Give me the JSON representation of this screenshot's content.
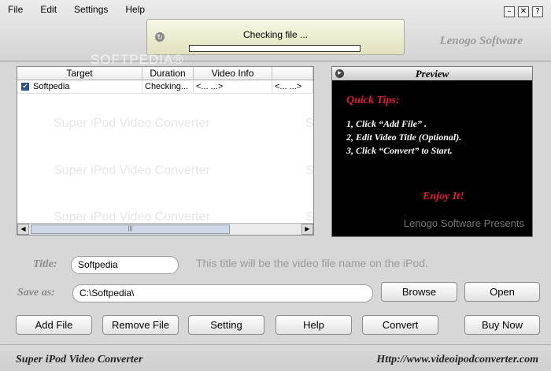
{
  "menu": [
    "File",
    "Edit",
    "Settings",
    "Help"
  ],
  "window_buttons": {
    "minimize": "–",
    "close": "✕",
    "help": "?"
  },
  "status": {
    "text": "Checking file ...",
    "progress": 0.0
  },
  "brand": "Lenogo Software",
  "watermark": "SOFTPEDIA®",
  "list": {
    "columns": [
      "Target",
      "Duration",
      "Video Info",
      ""
    ],
    "rows": [
      {
        "checked": true,
        "target": "Softpedia",
        "duration": "Checking...",
        "video_info": "<... ...>",
        "extra": "<... ...>"
      }
    ],
    "background_watermark": "Super iPod Video Converter",
    "background_watermark_right": "S",
    "scroll_left": "◀",
    "scroll_right": "▶",
    "scroll_grip": "|||"
  },
  "preview": {
    "title": "Preview",
    "tips_title": "Quick Tips:",
    "tips": [
      "1, Click “Add File” .",
      "2, Edit Video Title (Optional).",
      "3, Click “Convert” to Start."
    ],
    "enjoy": "Enjoy It!",
    "presents": "Lenogo Software Presents"
  },
  "form": {
    "title_label": "Title:",
    "title_value": "Softpedia",
    "title_hint": "This title will be the video file name on the iPod.",
    "saveas_label": "Save as:",
    "saveas_value": "C:\\Softpedia\\",
    "browse": "Browse",
    "open": "Open"
  },
  "buttons": [
    "Add File",
    "Remove File",
    "Setting",
    "Help",
    "Convert",
    "Buy Now"
  ],
  "footer": {
    "left": "Super iPod Video Converter",
    "right": "Http://www.videoipodconverter.com"
  }
}
